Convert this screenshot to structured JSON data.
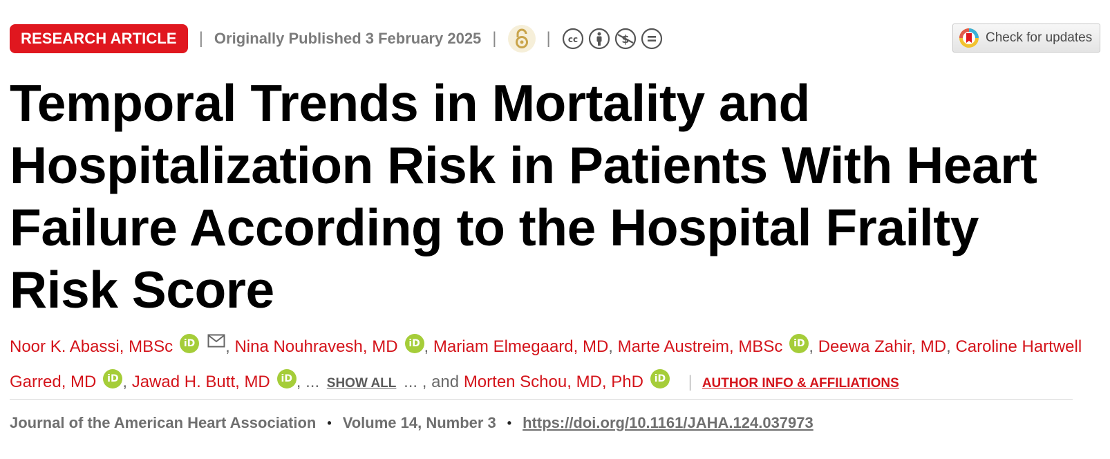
{
  "meta": {
    "article_type": "RESEARCH ARTICLE",
    "pub_date": "Originally Published 3 February 2025",
    "separator": "|",
    "license_icons": [
      "open-access-icon",
      "cc-icon",
      "cc-by-icon",
      "cc-nc-icon",
      "cc-nd-icon"
    ],
    "badge_color": "#e0171f"
  },
  "updates_button": {
    "label": "Check for updates"
  },
  "title": "Temporal Trends in Mortality and Hospitalization Risk in Patients With Heart Failure According to the Hospital Frailty Risk Score",
  "authors": {
    "list": [
      "Noor K. Abassi, MBSc",
      "Nina Nouhravesh, MD",
      "Mariam Elmegaard, MD",
      "Marte Austreim, MBSc",
      "Deewa Zahir, MD",
      "Caroline Hartwell Garred, MD",
      "Jawad H. Butt, MD",
      "Morten Schou, MD, PhD"
    ],
    "orcid_label": "iD",
    "comma": ",",
    "ellipsis_pre": ", ...",
    "show_all": "SHOW ALL",
    "ellipsis_post": "... , and",
    "sep": "|",
    "affiliations_link": "AUTHOR INFO & AFFILIATIONS",
    "author_color": "#d4141b",
    "orcid_color": "#a5cd39"
  },
  "journal": {
    "name": "Journal of the American Heart Association",
    "volume": "Volume 14, Number 3",
    "bullet": "•",
    "doi": "https://doi.org/10.1161/JAHA.124.037973"
  }
}
